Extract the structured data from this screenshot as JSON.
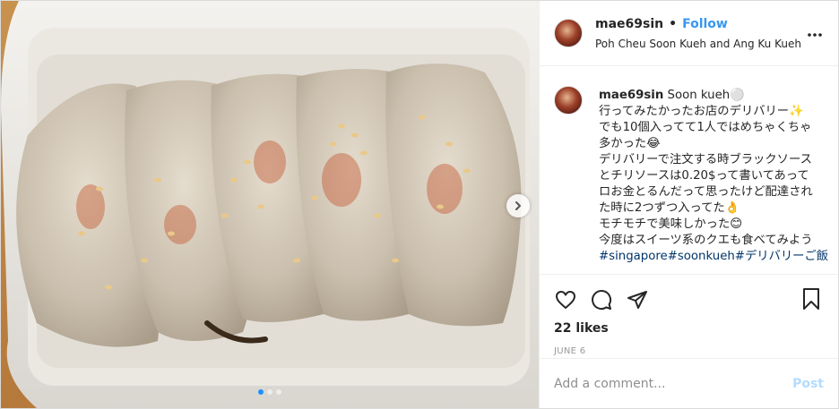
{
  "header": {
    "username": "mae69sin",
    "separator": "•",
    "follow_label": "Follow",
    "location": "Poh Cheu Soon Kueh and Ang Ku Kueh"
  },
  "caption": {
    "username": "mae69sin",
    "lines": [
      "Soon kueh⚪️",
      "行ってみたかったお店のデリバリー✨",
      "でも10個入ってて1人ではめちゃくちゃ",
      "多かった😂",
      "デリバリーで注文する時ブラックソース",
      "とチリソースは0.20$って書いてあって",
      "ロお金とるんだって思ったけど配達され",
      "た時に2つずつ入ってた👌",
      "モチモチで美味しかった😊",
      "今度はスイーツ系のクエも食べてみよう",
      "#singapore#soonkueh#デリバリーご飯"
    ]
  },
  "actions": {
    "likes": "22 likes",
    "date": "JUNE 6"
  },
  "comment": {
    "placeholder": "Add a comment...",
    "post_label": "Post"
  },
  "carousel": {
    "slides": 3,
    "active_index": 0
  },
  "icons": [
    "heart-icon",
    "comment-icon",
    "share-icon",
    "bookmark-icon",
    "more-icon",
    "chevron-right-icon"
  ],
  "colors": {
    "link": "#3897f0",
    "hashtag": "#003569",
    "post_disabled": "#b3dbff",
    "active_dot": "#1e90ff"
  }
}
